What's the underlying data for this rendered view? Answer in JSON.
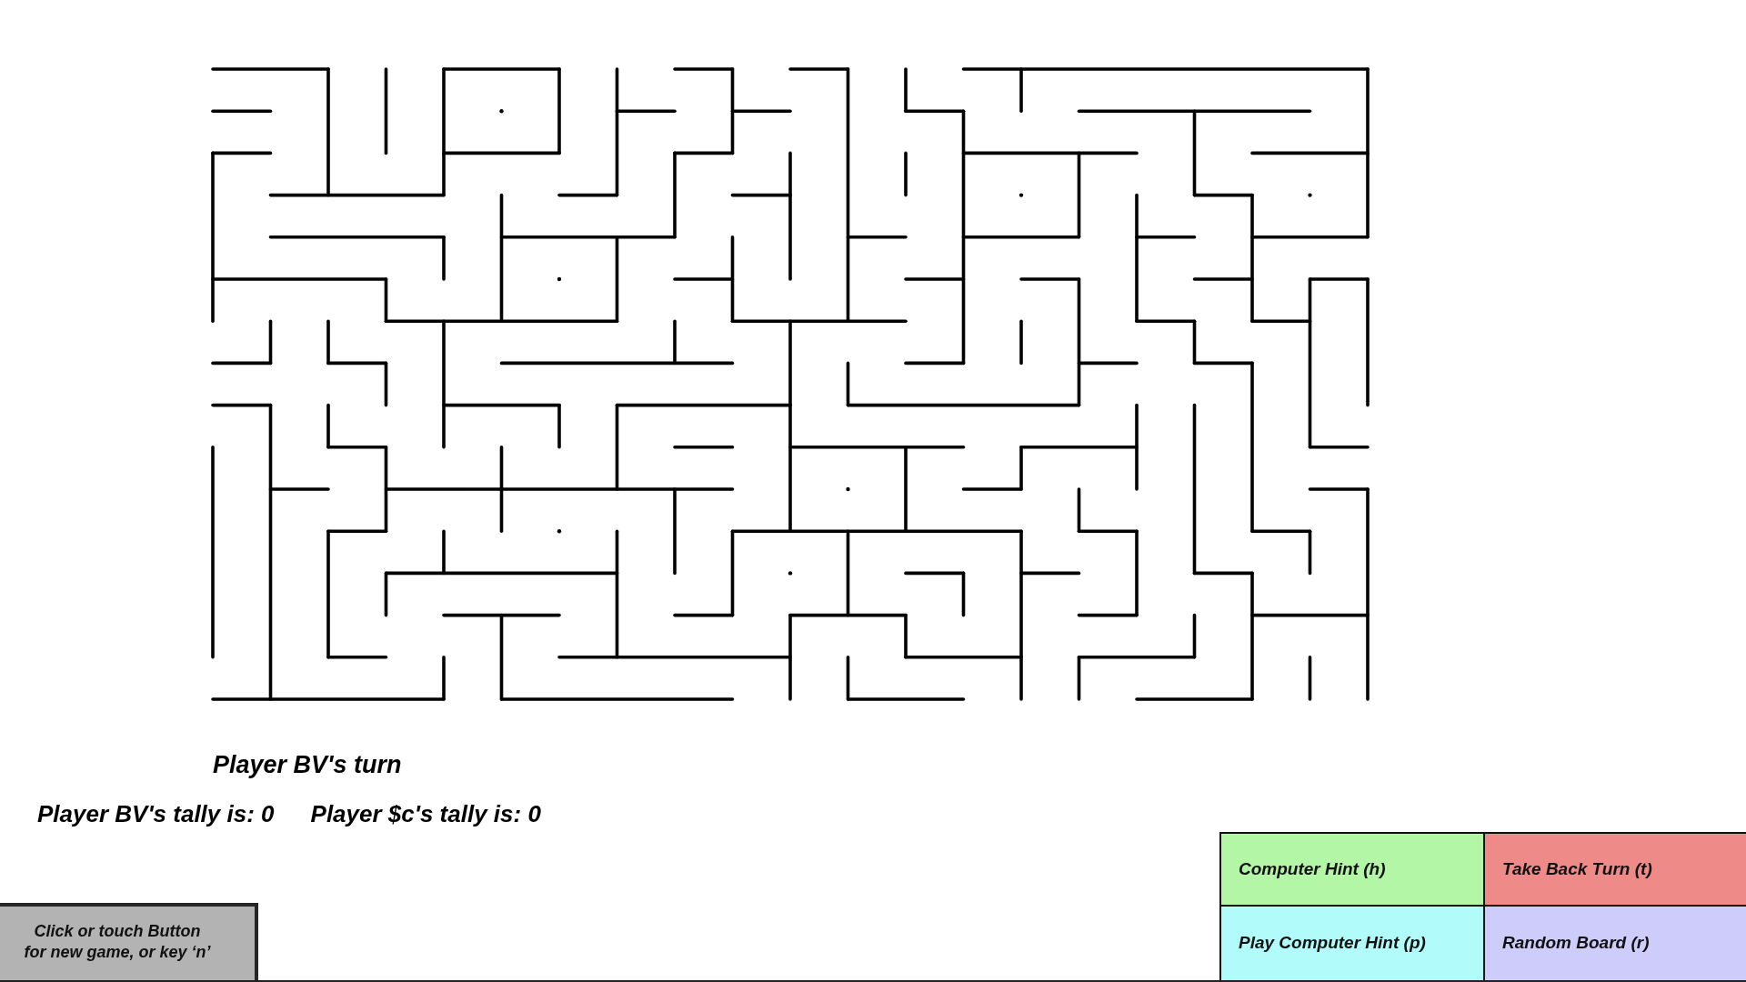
{
  "turn_label": "Player BV's turn",
  "tallies": [
    "Player BV's tally is: 0",
    "Player $c's tally is: 0"
  ],
  "new_game_button": {
    "lines": [
      "Click or touch Button",
      "for new game, or key ‘n’"
    ]
  },
  "buttons": [
    {
      "label": "Computer Hint (h)",
      "color": "#b3f6a6"
    },
    {
      "label": "Take Back Turn (t)",
      "color": "#ee8b89"
    },
    {
      "label": "Play Computer Hint (p)",
      "color": "#b1fbfb"
    },
    {
      "label": "Random Board (r)",
      "color": "#ceccfb"
    }
  ]
}
